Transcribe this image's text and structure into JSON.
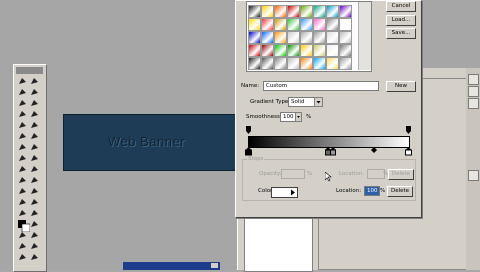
{
  "canvas": {
    "banner_text": "Web Banner"
  },
  "dialog": {
    "buttons": {
      "cancel": "Cancel",
      "load": "Load...",
      "save": "Save...",
      "new": "New",
      "delete": "Delete"
    },
    "name_label": "Name:",
    "name_value": "Custom",
    "gradient_type_label": "Gradient Type:",
    "gradient_type_value": "Solid",
    "smoothness_label": "Smoothness:",
    "smoothness_value": "100",
    "percent": "%",
    "stops_title": "Stops",
    "opacity_label": "Opacity:",
    "location_label": "Location:",
    "color_label": "Color:",
    "location_value": "100",
    "gradient_colors": [
      "#000000",
      "#ffffff"
    ]
  },
  "icons": [
    "toolbox-icons",
    "gradient-stop-icon",
    "dropdown-arrow-icon",
    "color-arrow-icon"
  ]
}
